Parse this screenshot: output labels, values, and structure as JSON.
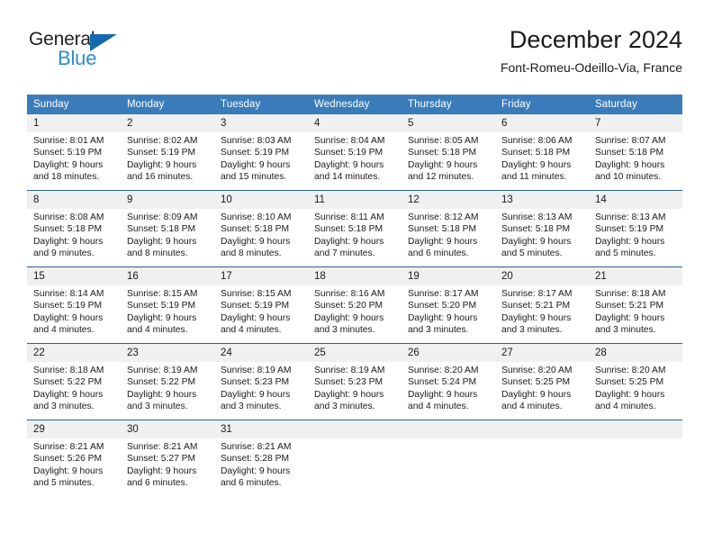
{
  "brand": {
    "name_top": "General",
    "name_bottom": "Blue",
    "triangle_color": "#1769ad",
    "bottom_color": "#2e8ccd"
  },
  "header": {
    "title": "December 2024",
    "subtitle": "Font-Romeu-Odeillo-Via, France"
  },
  "colors": {
    "header_row": "#3a7cba",
    "daynum_band": "#f0f0f0",
    "week_separator": "#2a6099"
  },
  "weekday_headers": [
    "Sunday",
    "Monday",
    "Tuesday",
    "Wednesday",
    "Thursday",
    "Friday",
    "Saturday"
  ],
  "weeks": [
    [
      {
        "day": "1",
        "sunrise": "Sunrise: 8:01 AM",
        "sunset": "Sunset: 5:19 PM",
        "daylight_1": "Daylight: 9 hours",
        "daylight_2": "and 18 minutes."
      },
      {
        "day": "2",
        "sunrise": "Sunrise: 8:02 AM",
        "sunset": "Sunset: 5:19 PM",
        "daylight_1": "Daylight: 9 hours",
        "daylight_2": "and 16 minutes."
      },
      {
        "day": "3",
        "sunrise": "Sunrise: 8:03 AM",
        "sunset": "Sunset: 5:19 PM",
        "daylight_1": "Daylight: 9 hours",
        "daylight_2": "and 15 minutes."
      },
      {
        "day": "4",
        "sunrise": "Sunrise: 8:04 AM",
        "sunset": "Sunset: 5:19 PM",
        "daylight_1": "Daylight: 9 hours",
        "daylight_2": "and 14 minutes."
      },
      {
        "day": "5",
        "sunrise": "Sunrise: 8:05 AM",
        "sunset": "Sunset: 5:18 PM",
        "daylight_1": "Daylight: 9 hours",
        "daylight_2": "and 12 minutes."
      },
      {
        "day": "6",
        "sunrise": "Sunrise: 8:06 AM",
        "sunset": "Sunset: 5:18 PM",
        "daylight_1": "Daylight: 9 hours",
        "daylight_2": "and 11 minutes."
      },
      {
        "day": "7",
        "sunrise": "Sunrise: 8:07 AM",
        "sunset": "Sunset: 5:18 PM",
        "daylight_1": "Daylight: 9 hours",
        "daylight_2": "and 10 minutes."
      }
    ],
    [
      {
        "day": "8",
        "sunrise": "Sunrise: 8:08 AM",
        "sunset": "Sunset: 5:18 PM",
        "daylight_1": "Daylight: 9 hours",
        "daylight_2": "and 9 minutes."
      },
      {
        "day": "9",
        "sunrise": "Sunrise: 8:09 AM",
        "sunset": "Sunset: 5:18 PM",
        "daylight_1": "Daylight: 9 hours",
        "daylight_2": "and 8 minutes."
      },
      {
        "day": "10",
        "sunrise": "Sunrise: 8:10 AM",
        "sunset": "Sunset: 5:18 PM",
        "daylight_1": "Daylight: 9 hours",
        "daylight_2": "and 8 minutes."
      },
      {
        "day": "11",
        "sunrise": "Sunrise: 8:11 AM",
        "sunset": "Sunset: 5:18 PM",
        "daylight_1": "Daylight: 9 hours",
        "daylight_2": "and 7 minutes."
      },
      {
        "day": "12",
        "sunrise": "Sunrise: 8:12 AM",
        "sunset": "Sunset: 5:18 PM",
        "daylight_1": "Daylight: 9 hours",
        "daylight_2": "and 6 minutes."
      },
      {
        "day": "13",
        "sunrise": "Sunrise: 8:13 AM",
        "sunset": "Sunset: 5:18 PM",
        "daylight_1": "Daylight: 9 hours",
        "daylight_2": "and 5 minutes."
      },
      {
        "day": "14",
        "sunrise": "Sunrise: 8:13 AM",
        "sunset": "Sunset: 5:19 PM",
        "daylight_1": "Daylight: 9 hours",
        "daylight_2": "and 5 minutes."
      }
    ],
    [
      {
        "day": "15",
        "sunrise": "Sunrise: 8:14 AM",
        "sunset": "Sunset: 5:19 PM",
        "daylight_1": "Daylight: 9 hours",
        "daylight_2": "and 4 minutes."
      },
      {
        "day": "16",
        "sunrise": "Sunrise: 8:15 AM",
        "sunset": "Sunset: 5:19 PM",
        "daylight_1": "Daylight: 9 hours",
        "daylight_2": "and 4 minutes."
      },
      {
        "day": "17",
        "sunrise": "Sunrise: 8:15 AM",
        "sunset": "Sunset: 5:19 PM",
        "daylight_1": "Daylight: 9 hours",
        "daylight_2": "and 4 minutes."
      },
      {
        "day": "18",
        "sunrise": "Sunrise: 8:16 AM",
        "sunset": "Sunset: 5:20 PM",
        "daylight_1": "Daylight: 9 hours",
        "daylight_2": "and 3 minutes."
      },
      {
        "day": "19",
        "sunrise": "Sunrise: 8:17 AM",
        "sunset": "Sunset: 5:20 PM",
        "daylight_1": "Daylight: 9 hours",
        "daylight_2": "and 3 minutes."
      },
      {
        "day": "20",
        "sunrise": "Sunrise: 8:17 AM",
        "sunset": "Sunset: 5:21 PM",
        "daylight_1": "Daylight: 9 hours",
        "daylight_2": "and 3 minutes."
      },
      {
        "day": "21",
        "sunrise": "Sunrise: 8:18 AM",
        "sunset": "Sunset: 5:21 PM",
        "daylight_1": "Daylight: 9 hours",
        "daylight_2": "and 3 minutes."
      }
    ],
    [
      {
        "day": "22",
        "sunrise": "Sunrise: 8:18 AM",
        "sunset": "Sunset: 5:22 PM",
        "daylight_1": "Daylight: 9 hours",
        "daylight_2": "and 3 minutes."
      },
      {
        "day": "23",
        "sunrise": "Sunrise: 8:19 AM",
        "sunset": "Sunset: 5:22 PM",
        "daylight_1": "Daylight: 9 hours",
        "daylight_2": "and 3 minutes."
      },
      {
        "day": "24",
        "sunrise": "Sunrise: 8:19 AM",
        "sunset": "Sunset: 5:23 PM",
        "daylight_1": "Daylight: 9 hours",
        "daylight_2": "and 3 minutes."
      },
      {
        "day": "25",
        "sunrise": "Sunrise: 8:19 AM",
        "sunset": "Sunset: 5:23 PM",
        "daylight_1": "Daylight: 9 hours",
        "daylight_2": "and 3 minutes."
      },
      {
        "day": "26",
        "sunrise": "Sunrise: 8:20 AM",
        "sunset": "Sunset: 5:24 PM",
        "daylight_1": "Daylight: 9 hours",
        "daylight_2": "and 4 minutes."
      },
      {
        "day": "27",
        "sunrise": "Sunrise: 8:20 AM",
        "sunset": "Sunset: 5:25 PM",
        "daylight_1": "Daylight: 9 hours",
        "daylight_2": "and 4 minutes."
      },
      {
        "day": "28",
        "sunrise": "Sunrise: 8:20 AM",
        "sunset": "Sunset: 5:25 PM",
        "daylight_1": "Daylight: 9 hours",
        "daylight_2": "and 4 minutes."
      }
    ],
    [
      {
        "day": "29",
        "sunrise": "Sunrise: 8:21 AM",
        "sunset": "Sunset: 5:26 PM",
        "daylight_1": "Daylight: 9 hours",
        "daylight_2": "and 5 minutes."
      },
      {
        "day": "30",
        "sunrise": "Sunrise: 8:21 AM",
        "sunset": "Sunset: 5:27 PM",
        "daylight_1": "Daylight: 9 hours",
        "daylight_2": "and 6 minutes."
      },
      {
        "day": "31",
        "sunrise": "Sunrise: 8:21 AM",
        "sunset": "Sunset: 5:28 PM",
        "daylight_1": "Daylight: 9 hours",
        "daylight_2": "and 6 minutes."
      },
      {
        "day": "",
        "sunrise": "",
        "sunset": "",
        "daylight_1": "",
        "daylight_2": ""
      },
      {
        "day": "",
        "sunrise": "",
        "sunset": "",
        "daylight_1": "",
        "daylight_2": ""
      },
      {
        "day": "",
        "sunrise": "",
        "sunset": "",
        "daylight_1": "",
        "daylight_2": ""
      },
      {
        "day": "",
        "sunrise": "",
        "sunset": "",
        "daylight_1": "",
        "daylight_2": ""
      }
    ]
  ]
}
